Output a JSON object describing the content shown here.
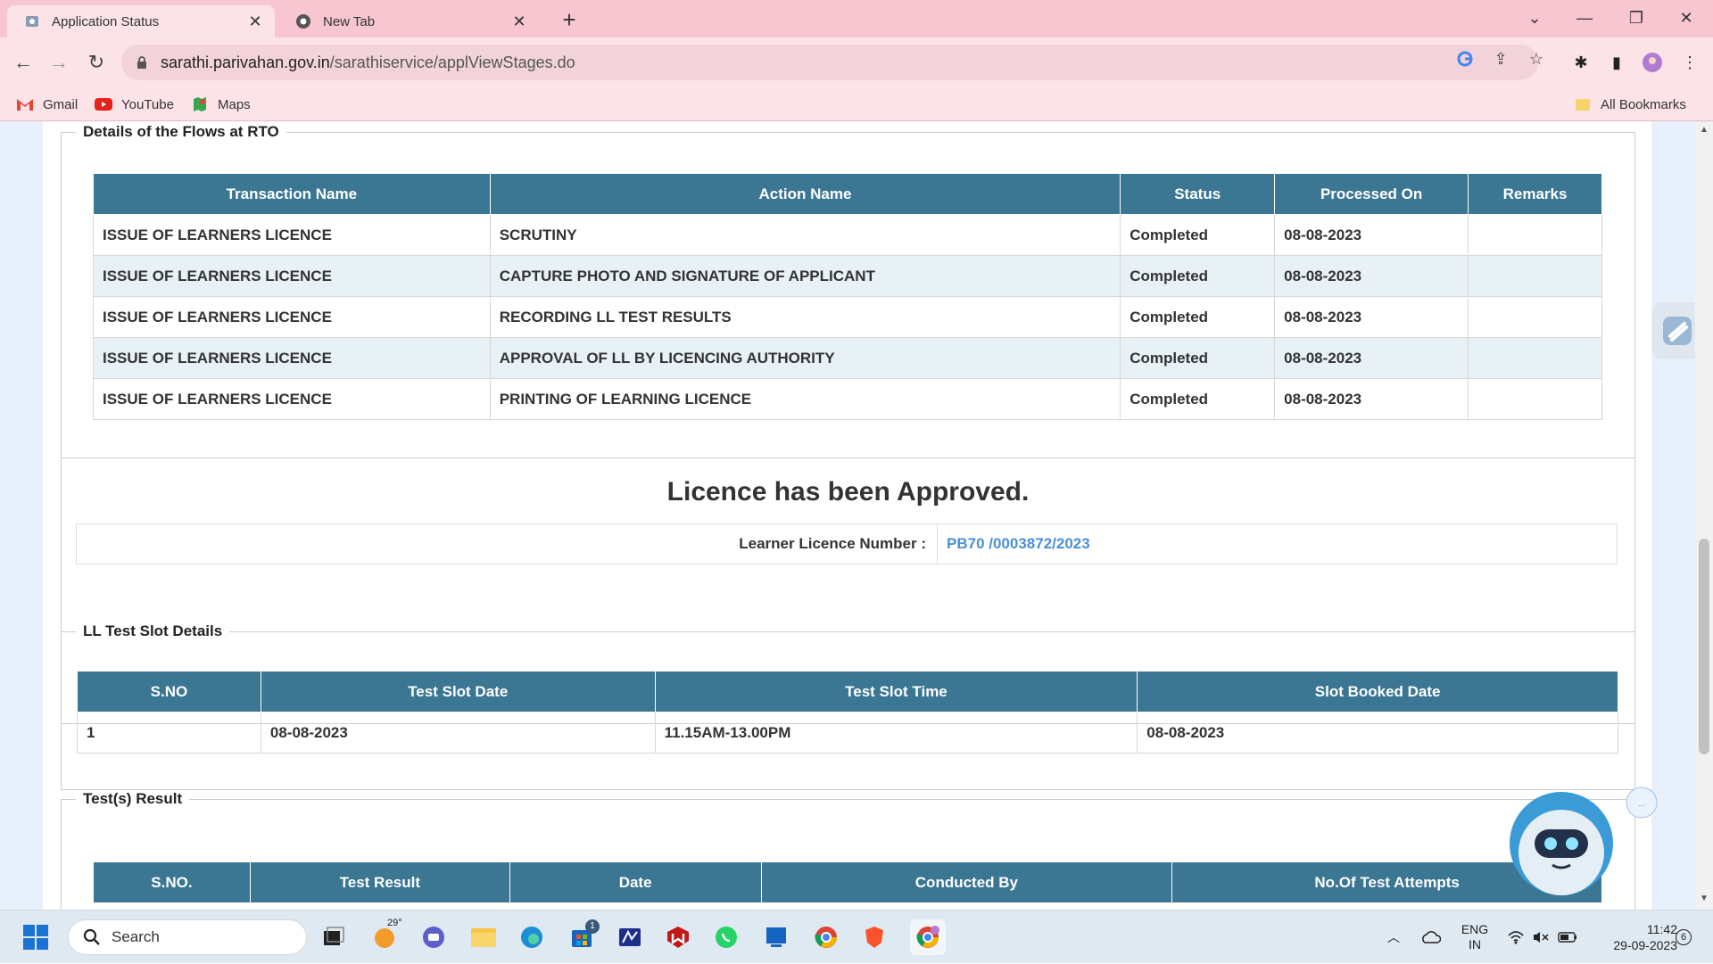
{
  "browser": {
    "tabs": [
      {
        "title": "Application Status",
        "active": true
      },
      {
        "title": "New Tab",
        "active": false
      }
    ],
    "url_domain": "sarathi.parivahan.gov.in",
    "url_path": "/sarathiservice/applViewStages.do",
    "bookmarks": [
      "Gmail",
      "YouTube",
      "Maps"
    ],
    "all_bookmarks": "All Bookmarks"
  },
  "flows": {
    "legend": "Details of the Flows at RTO",
    "headers": [
      "Transaction Name",
      "Action Name",
      "Status",
      "Processed On",
      "Remarks"
    ],
    "rows": [
      [
        "ISSUE OF LEARNERS LICENCE",
        "SCRUTINY",
        "Completed",
        "08-08-2023",
        ""
      ],
      [
        "ISSUE OF LEARNERS LICENCE",
        "CAPTURE PHOTO AND SIGNATURE OF APPLICANT",
        "Completed",
        "08-08-2023",
        ""
      ],
      [
        "ISSUE OF LEARNERS LICENCE",
        "RECORDING LL TEST RESULTS",
        "Completed",
        "08-08-2023",
        ""
      ],
      [
        "ISSUE OF LEARNERS LICENCE",
        "APPROVAL OF LL BY LICENCING AUTHORITY",
        "Completed",
        "08-08-2023",
        ""
      ],
      [
        "ISSUE OF LEARNERS LICENCE",
        "PRINTING OF LEARNING LICENCE",
        "Completed",
        "08-08-2023",
        ""
      ]
    ]
  },
  "approval": {
    "message": "Licence has been Approved.",
    "label": "Learner Licence Number :",
    "number": "PB70 /0003872/2023"
  },
  "slot": {
    "legend": "LL Test Slot Details",
    "headers": [
      "S.NO",
      "Test Slot Date",
      "Test Slot Time",
      "Slot Booked Date"
    ],
    "rows": [
      [
        "1",
        "08-08-2023",
        "11.15AM-13.00PM",
        "08-08-2023"
      ]
    ]
  },
  "results": {
    "legend": "Test(s) Result",
    "headers": [
      "S.NO.",
      "Test Result",
      "Date",
      "Conducted By",
      "No.Of Test Attempts"
    ]
  },
  "taskbar": {
    "search_placeholder": "Search",
    "weather": "29°",
    "badge_store": "1",
    "lang_top": "ENG",
    "lang_bottom": "IN",
    "time": "11:42",
    "date": "29-09-2023",
    "notif_count": "6"
  },
  "colors": {
    "header_bg": "#3b7693",
    "link_blue": "#4a90d9",
    "browser_pink": "#f7c6d0"
  }
}
